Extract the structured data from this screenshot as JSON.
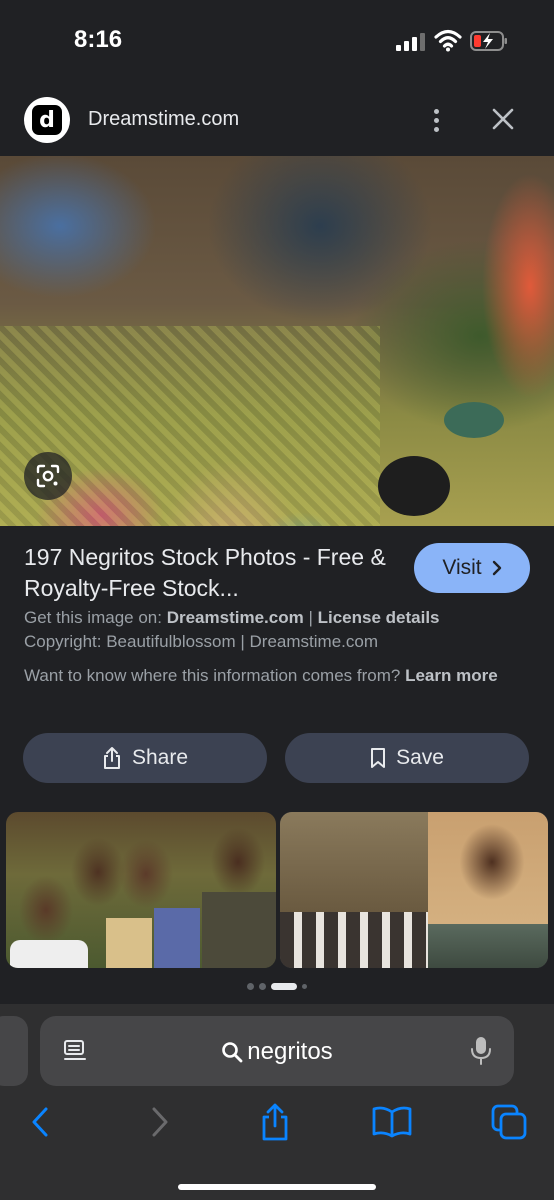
{
  "status_bar": {
    "time": "8:16"
  },
  "source": {
    "logo_letter": "d",
    "name": "Dreamstime.com"
  },
  "hero": {
    "lens_icon": "google-lens-icon"
  },
  "result": {
    "title": "197 Negritos Stock Photos - Free & Royalty-Free Stock...",
    "visit_label": "Visit",
    "get_image_prefix": "Get this image on:",
    "get_image_site": "Dreamstime.com",
    "separator": "|",
    "license_label": "License details",
    "copyright": "Copyright: Beautifulblossom | Dreamstime.com",
    "info_question": "Want to know where this information comes from?",
    "learn_more": "Learn more"
  },
  "actions": {
    "share_label": "Share",
    "save_label": "Save"
  },
  "browser": {
    "query": "negritos"
  },
  "colors": {
    "background": "#202124",
    "accent": "#8ab4f8",
    "button": "#3c4252",
    "toolbar_blue": "#0a84ff"
  }
}
